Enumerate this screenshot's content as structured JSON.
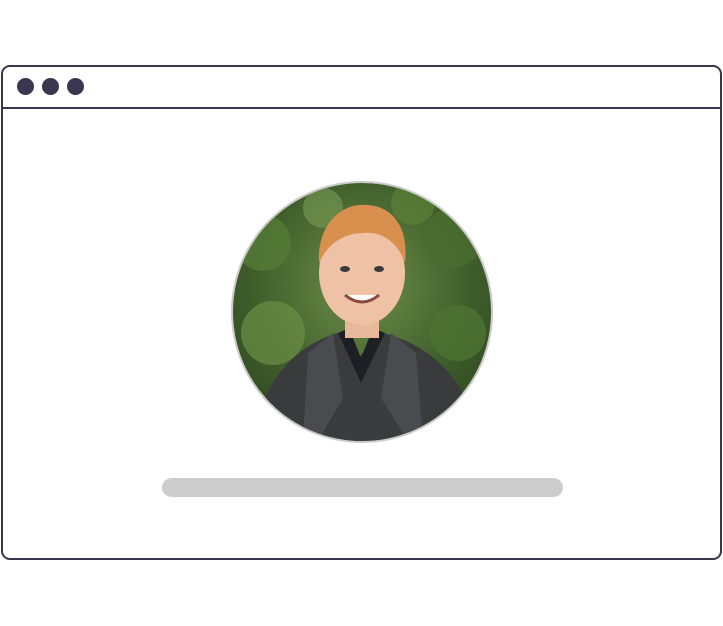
{
  "window": {
    "controls": [
      "window-dot",
      "window-dot",
      "window-dot"
    ]
  },
  "colors": {
    "frame": "#3a3650",
    "placeholder": "#cccccc",
    "avatar_border": "#c9c9c9"
  },
  "profile": {
    "avatar_icon": "person-photo",
    "name_placeholder": "text-placeholder"
  }
}
